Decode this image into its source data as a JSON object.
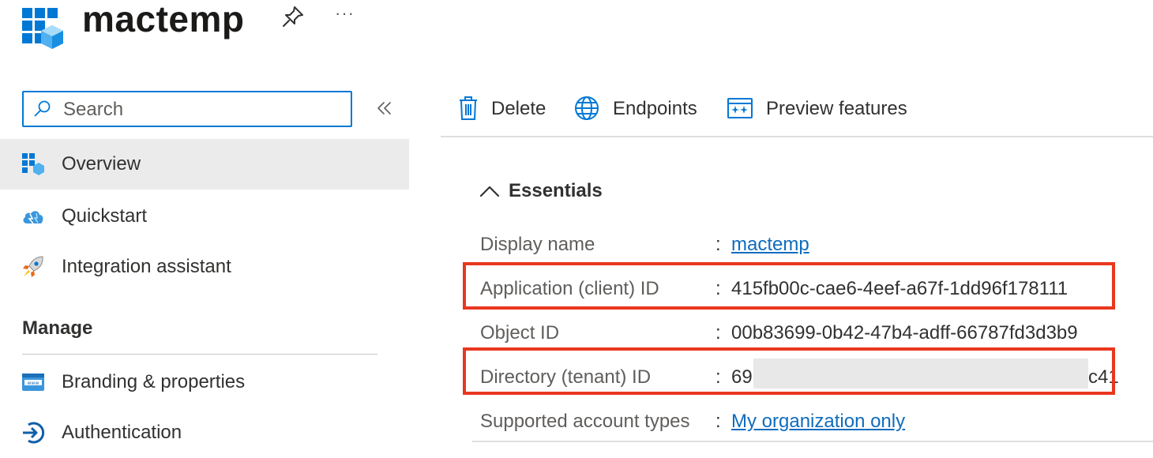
{
  "header": {
    "title": "mactemp",
    "app_icon": "app-registration-icon",
    "pin_icon": "pin-icon",
    "more_label": "···"
  },
  "sidebar": {
    "search": {
      "placeholder": "Search",
      "value": ""
    },
    "collapse_label": "«",
    "items": [
      {
        "label": "Overview",
        "icon": "overview-icon",
        "selected": true
      },
      {
        "label": "Quickstart",
        "icon": "quickstart-cloud-icon"
      },
      {
        "label": "Integration assistant",
        "icon": "rocket-icon"
      }
    ],
    "manage_heading": "Manage",
    "manage_items": [
      {
        "label": "Branding & properties",
        "icon": "branding-icon"
      },
      {
        "label": "Authentication",
        "icon": "authentication-icon"
      }
    ]
  },
  "toolbar": {
    "delete_label": "Delete",
    "endpoints_label": "Endpoints",
    "preview_label": "Preview features"
  },
  "essentials": {
    "heading": "Essentials",
    "separator": ":",
    "rows": [
      {
        "key": "Display name",
        "value": "mactemp",
        "is_link": true
      },
      {
        "key": "Application (client) ID",
        "value": "415fb00c-cae6-4eef-a67f-1dd96f178111",
        "highlighted": true
      },
      {
        "key": "Object ID",
        "value": "00b83699-0b42-47b4-adff-66787fd3d3b9"
      },
      {
        "key": "Directory (tenant) ID",
        "value_prefix": "69",
        "value_suffix": "c41",
        "redacted": true,
        "highlighted": true
      },
      {
        "key": "Supported account types",
        "value": "My organization only",
        "is_link": true
      }
    ]
  },
  "colors": {
    "accent": "#0078d4",
    "link": "#0f6cbd",
    "highlight": "#e8371f",
    "selected_bg": "#ebebeb"
  }
}
